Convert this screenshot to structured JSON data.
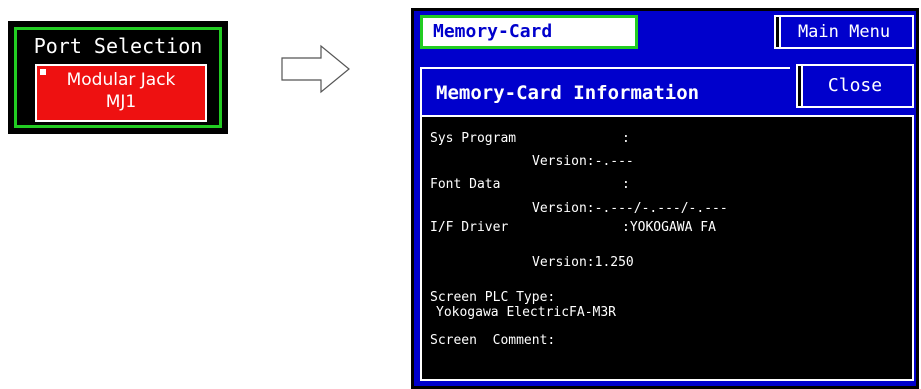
{
  "port_selection": {
    "title": "Port Selection",
    "button_line1": "Modular Jack",
    "button_line2": "MJ1"
  },
  "arrow": {
    "icon": "right-arrow-icon"
  },
  "memory_card": {
    "title": "Memory-Card",
    "main_menu_label": "Main Menu",
    "info_title": "Memory-Card Information",
    "close_label": "Close",
    "rows": {
      "sys_program_label": "Sys Program",
      "sys_program_sep": ":",
      "sys_version_label": "Version:",
      "sys_version_value": "-.---",
      "font_data_label": "Font Data",
      "font_data_sep": ":",
      "font_version_label": "Version:",
      "font_version_value": "-.---/-.---/-.---",
      "if_driver_label": "I/F Driver",
      "if_driver_value": ":YOKOGAWA FA",
      "if_version_label": "Version:",
      "if_version_value": "1.250",
      "plc_type_label": "Screen PLC Type:",
      "plc_type_value": "Yokogawa ElectricFA-M3R",
      "comment_label": "Screen  Comment:"
    }
  },
  "colors": {
    "screen_blue": "#0000cc",
    "accent_green": "#22cc22",
    "button_red": "#ee1111"
  }
}
